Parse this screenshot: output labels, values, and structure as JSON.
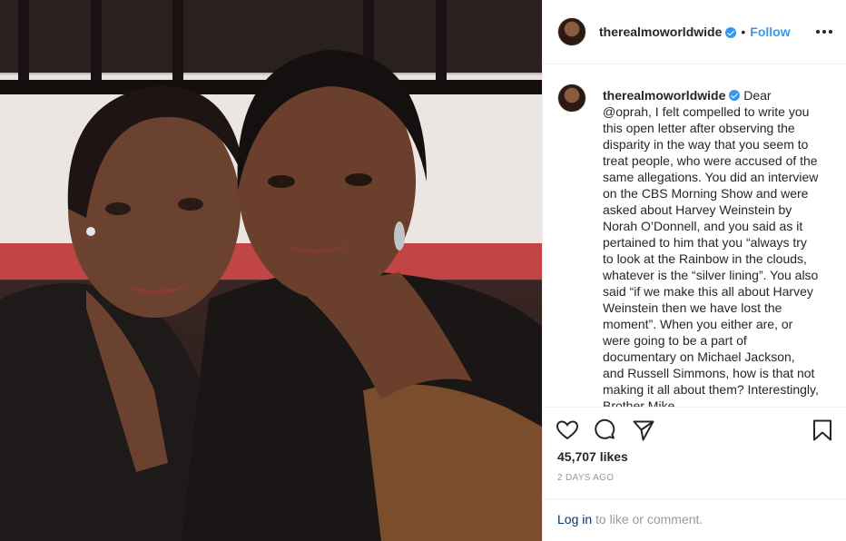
{
  "post": {
    "username": "therealmoworldwide",
    "separator": "•",
    "follow_label": "Follow",
    "caption": "Dear @oprah, I felt compelled to write you this open letter after observing the disparity in the way that you seem to treat people, who were accused of the same allegations. You did an interview on the CBS Morning Show and were asked about Harvey Weinstein by Norah O’Donnell, and you said as it pertained to him that you “always try to look at the Rainbow in the clouds, whatever is the “silver lining”. You also said “if we make this all about Harvey Weinstein then we have lost the moment”. When you either are, or were going to be a part of documentary on Michael Jackson, and Russell Simmons, how is that not making it all about them? Interestingly, Brother Mike",
    "likes": "45,707 likes",
    "time": "2 DAYS AGO",
    "login_link": "Log in",
    "login_suffix": " to like or comment."
  },
  "icons": {
    "verified": "verified-badge-icon",
    "more": "more-options-icon",
    "like": "heart-icon",
    "comment": "comment-icon",
    "share": "share-icon",
    "save": "bookmark-icon"
  },
  "colors": {
    "accent": "#3897f0",
    "text": "#262626",
    "muted": "#999999",
    "link": "#003569"
  }
}
